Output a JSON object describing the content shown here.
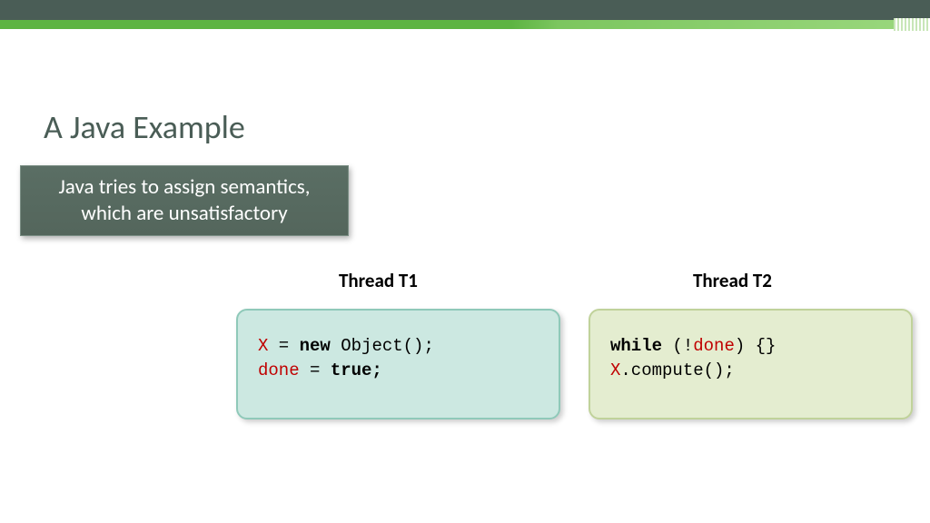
{
  "title": "A Java Example",
  "callout": "Java tries to assign semantics, which are unsatisfactory",
  "threads": {
    "t1": {
      "heading": "Thread T1",
      "code": {
        "line1_x": "X",
        "line1_eq": " = ",
        "line1_new": "new",
        "line1_obj": " Object();",
        "line2_done": "done",
        "line2_eq": " = ",
        "line2_true": "true;"
      }
    },
    "t2": {
      "heading": "Thread T2",
      "code": {
        "line1_while": "while",
        "line1_sp": " (!",
        "line1_done": "done",
        "line1_end": ") {}",
        "line2_x": "X",
        "line2_comp": ".compute();"
      }
    }
  }
}
